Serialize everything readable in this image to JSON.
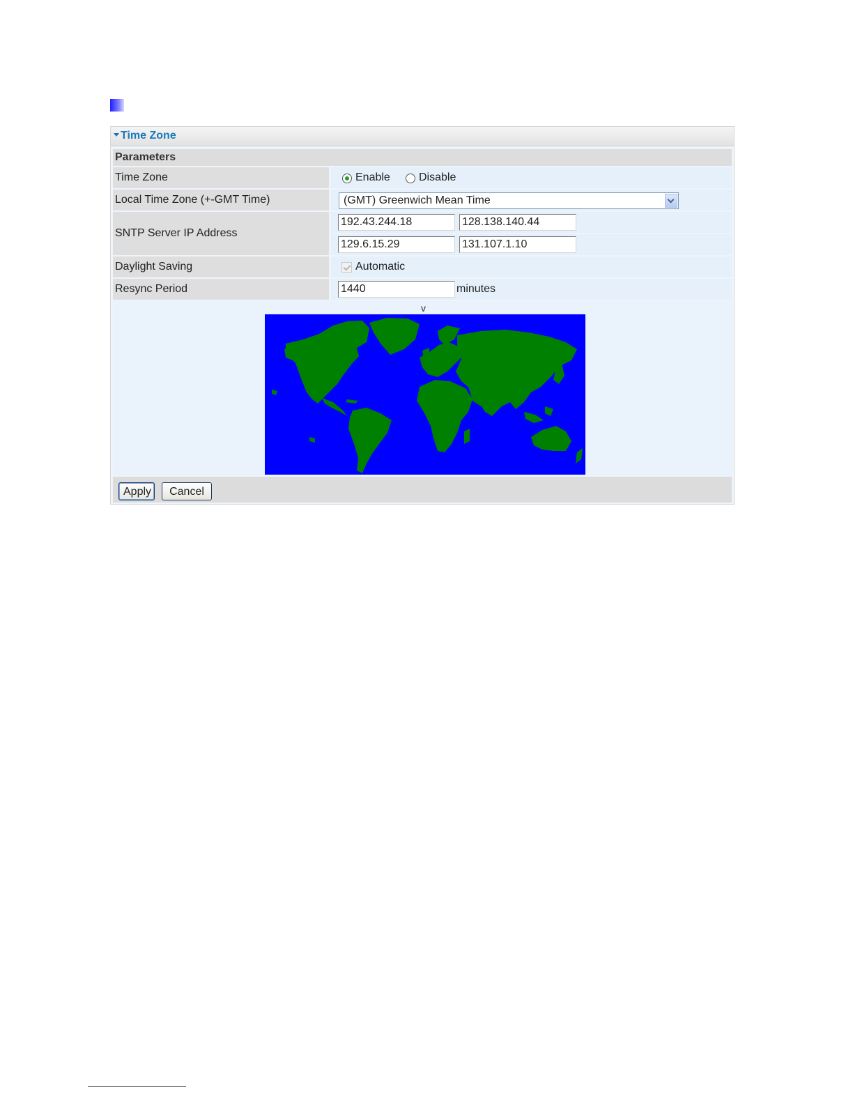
{
  "panel": {
    "title": "Time Zone"
  },
  "section": {
    "title": "Parameters"
  },
  "rows": {
    "time_zone": {
      "label": "Time Zone",
      "enable_label": "Enable",
      "disable_label": "Disable",
      "selected": "Enable"
    },
    "local_time_zone": {
      "label": "Local Time Zone (+-GMT Time)",
      "selected": "(GMT) Greenwich Mean Time"
    },
    "sntp": {
      "label": "SNTP Server IP Address",
      "servers": [
        "192.43.244.18",
        "128.138.140.44",
        "129.6.15.29",
        "131.107.1.10"
      ]
    },
    "daylight_saving": {
      "label": "Daylight Saving",
      "option": "Automatic",
      "checked": true,
      "disabled": true
    },
    "resync": {
      "label": "Resync Period",
      "value": "1440",
      "unit": "minutes"
    }
  },
  "map": {
    "marker": "v",
    "ocean_color": "#0000ff",
    "land_color": "#008000"
  },
  "buttons": {
    "apply": "Apply",
    "cancel": "Cancel"
  },
  "colors": {
    "title": "#1a7ab8",
    "label_bg": "#dedede",
    "value_bg": "#e6f0fa"
  }
}
